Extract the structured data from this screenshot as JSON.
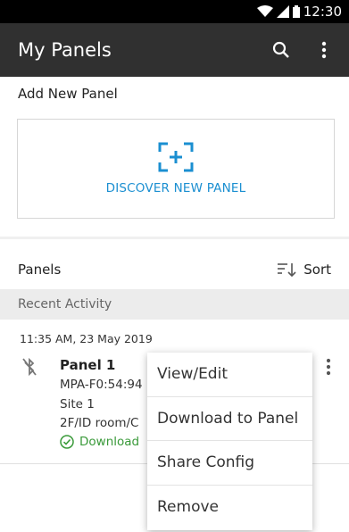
{
  "status_bar": {
    "time": "12:30"
  },
  "app_bar": {
    "title": "My Panels",
    "icons": [
      "search-icon",
      "more-vert-icon"
    ]
  },
  "add_section": {
    "label": "Add New Panel",
    "discover_label": "DISCOVER NEW PANEL",
    "discover_icon": "scan-add-icon"
  },
  "panels_section": {
    "title": "Panels",
    "sort_label": "Sort",
    "sort_icon": "sort-icon"
  },
  "recent": {
    "label": "Recent Activity",
    "timestamp": "11:35 AM, 23 May 2019",
    "panel": {
      "name": "Panel 1",
      "id": "MPA-F0:54:94",
      "site": "Site 1",
      "location": "2F/ID room/C",
      "status": "Download",
      "bluetooth_icon": "bluetooth-disabled-icon",
      "status_icon": "check-circle-icon"
    }
  },
  "context_menu": {
    "items": [
      "View/Edit",
      "Download to Panel",
      "Share Config",
      "Remove"
    ]
  },
  "colors": {
    "accent": "#1b8fd1",
    "app_bar": "#303030",
    "success": "#3a9a3a"
  }
}
